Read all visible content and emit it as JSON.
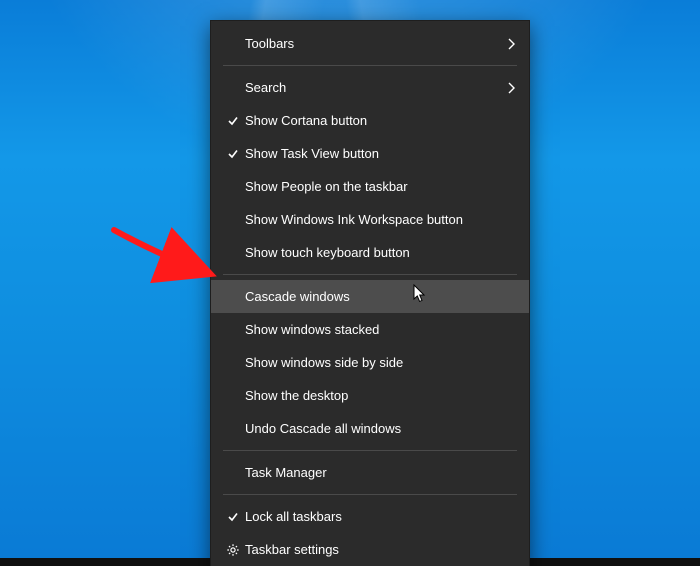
{
  "menu": {
    "items": {
      "toolbars": {
        "label": "Toolbars"
      },
      "search": {
        "label": "Search"
      },
      "cortana": {
        "label": "Show Cortana button"
      },
      "taskview": {
        "label": "Show Task View button"
      },
      "people": {
        "label": "Show People on the taskbar"
      },
      "ink": {
        "label": "Show Windows Ink Workspace button"
      },
      "touchkb": {
        "label": "Show touch keyboard button"
      },
      "cascade": {
        "label": "Cascade windows"
      },
      "stacked": {
        "label": "Show windows stacked"
      },
      "sidebyside": {
        "label": "Show windows side by side"
      },
      "desktop": {
        "label": "Show the desktop"
      },
      "undo": {
        "label": "Undo Cascade all windows"
      },
      "taskmgr": {
        "label": "Task Manager"
      },
      "lock": {
        "label": "Lock all taskbars"
      },
      "settings": {
        "label": "Taskbar settings"
      }
    }
  }
}
